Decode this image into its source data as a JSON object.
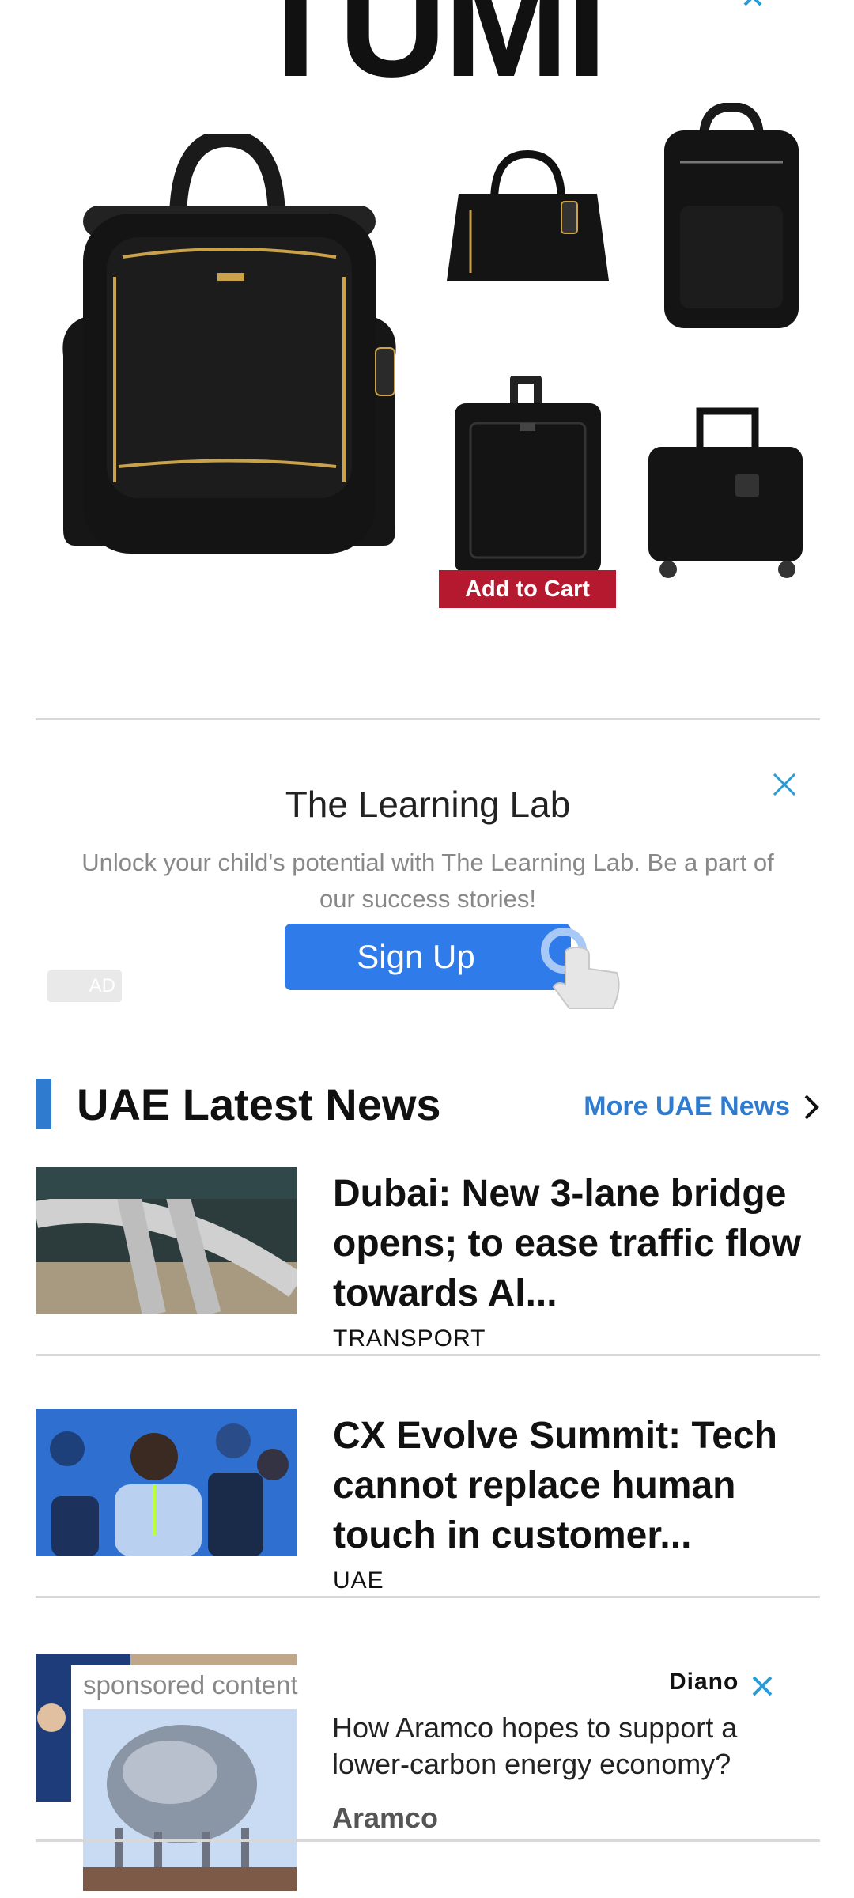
{
  "tumi_ad": {
    "logo_text": "TUMI",
    "add_to_cart_label": "Add to Cart",
    "brand_color": "#b5192f"
  },
  "learning_lab_ad": {
    "title": "The Learning Lab",
    "description": "Unlock your child's potential with The Learning Lab. Be a part of our success stories!",
    "button_label": "Sign Up",
    "ad_badge": "AD",
    "accent_color": "#2f7bea"
  },
  "news": {
    "section_title": "UAE Latest News",
    "more_link": "More UAE News",
    "accent_color": "#2f7bcf",
    "items": [
      {
        "headline": "Dubai: New 3-lane bridge opens; to ease traffic flow towards Al...",
        "category": "TRANSPORT"
      },
      {
        "headline": "CX Evolve Summit: Tech cannot replace human touch in customer...",
        "category": "UAE"
      }
    ]
  },
  "sponsored": {
    "label": "sponsored content",
    "network": "Diano",
    "headline": "How Aramco hopes to support a lower-carbon energy economy?",
    "advertiser": "Aramco"
  }
}
